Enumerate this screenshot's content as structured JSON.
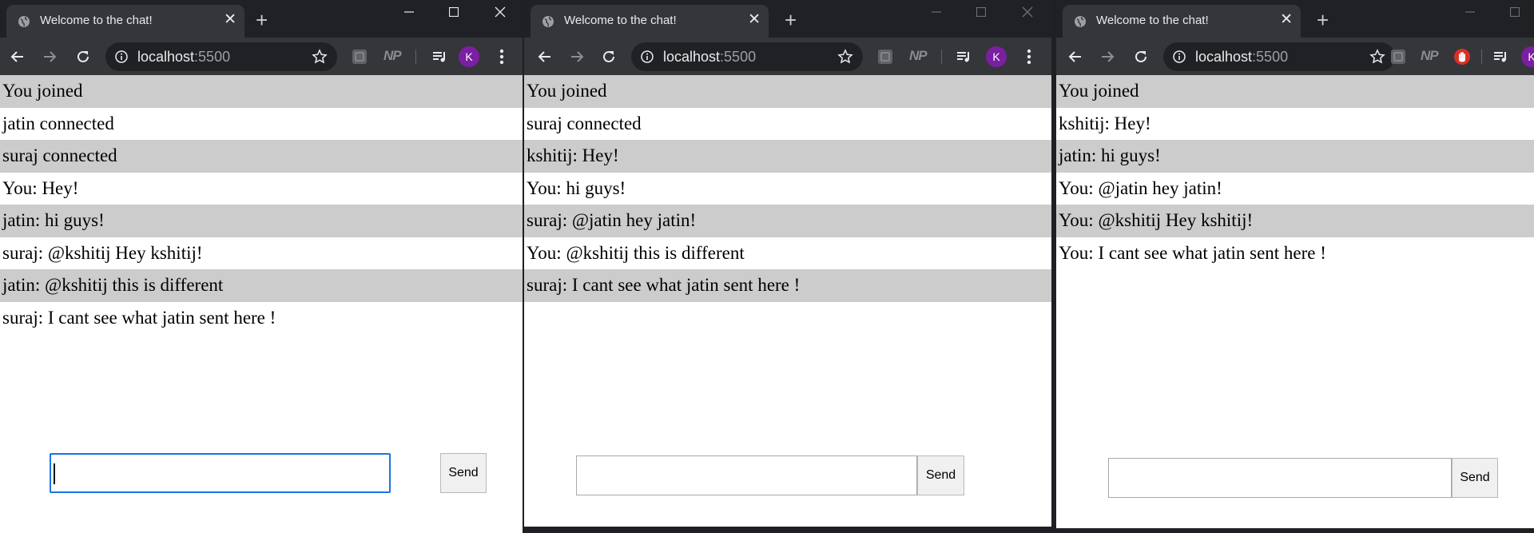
{
  "windows": [
    {
      "tab_title": "Welcome to the chat!",
      "url_host": "localhost",
      "url_port": ":5500",
      "avatar_letter": "K",
      "extensions": [
        "grey-square-extension",
        "np-extension"
      ],
      "messages": [
        "You joined",
        "jatin connected",
        "suraj connected",
        "You: Hey!",
        "jatin: hi guys!",
        "suraj: @kshitij Hey kshitij!",
        "jatin: @kshitij this is different",
        "suraj: I cant see what jatin sent here !"
      ],
      "input_value": "",
      "input_focused": true,
      "send_label": "Send"
    },
    {
      "tab_title": "Welcome to the chat!",
      "url_host": "localhost",
      "url_port": ":5500",
      "avatar_letter": "K",
      "extensions": [
        "grey-square-extension",
        "np-extension"
      ],
      "messages": [
        "You joined",
        "suraj connected",
        "kshitij: Hey!",
        "You: hi guys!",
        "suraj: @jatin hey jatin!",
        "You: @kshitij this is different",
        "suraj: I cant see what jatin sent here !"
      ],
      "input_value": "",
      "input_focused": false,
      "send_label": "Send"
    },
    {
      "tab_title": "Welcome to the chat!",
      "url_host": "localhost",
      "url_port": ":5500",
      "avatar_letter": "K",
      "extensions": [
        "grey-square-extension",
        "np-extension",
        "red-hand-stop-extension"
      ],
      "messages": [
        "You joined",
        "kshitij: Hey!",
        "jatin: hi guys!",
        "You: @jatin hey jatin!",
        "You: @kshitij Hey kshitij!",
        "You: I cant see what jatin sent here !"
      ],
      "input_value": "",
      "input_focused": false,
      "send_label": "Send"
    }
  ],
  "colors": {
    "tabstrip": "#202124",
    "toolbar": "#35363a",
    "row_alt": "#cccccc",
    "focus_ring": "#1a73e8",
    "avatar": "#7b1fa2"
  }
}
